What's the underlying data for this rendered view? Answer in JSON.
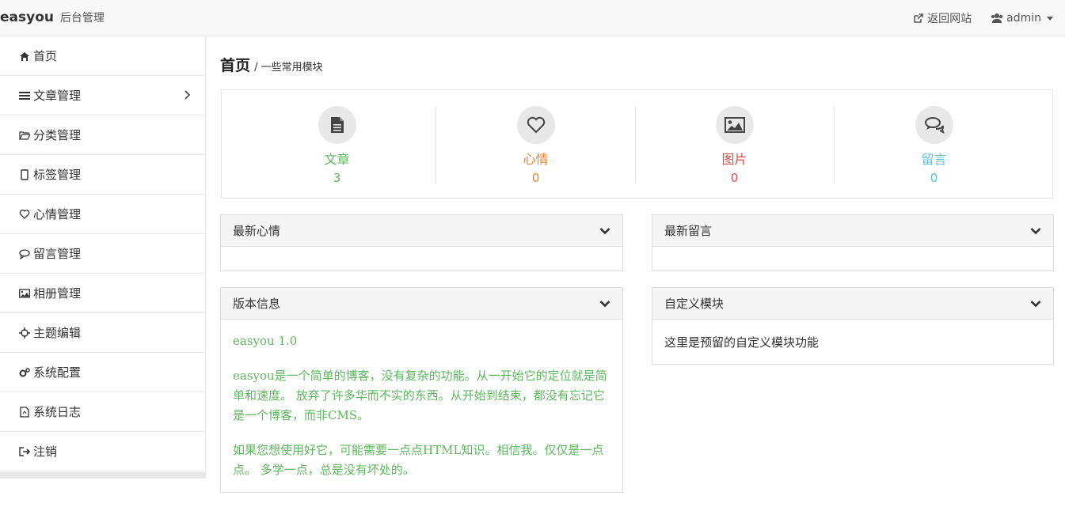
{
  "brand": {
    "name": "easyou",
    "subtitle": "后台管理"
  },
  "topnav": {
    "back_label": "返回网站",
    "user_label": "admin"
  },
  "sidebar": {
    "items": [
      {
        "label": "首页",
        "icon": "home-icon"
      },
      {
        "label": "文章管理",
        "icon": "bars-icon"
      },
      {
        "label": "分类管理",
        "icon": "folder-open-icon"
      },
      {
        "label": "标签管理",
        "icon": "tag-icon"
      },
      {
        "label": "心情管理",
        "icon": "heart-icon"
      },
      {
        "label": "留言管理",
        "icon": "comment-icon"
      },
      {
        "label": "相册管理",
        "icon": "picture-icon"
      },
      {
        "label": "主题编辑",
        "icon": "crosshairs-icon"
      },
      {
        "label": "系统配置",
        "icon": "gears-icon"
      },
      {
        "label": "系统日志",
        "icon": "file-icon"
      },
      {
        "label": "注销",
        "icon": "sign-out-icon"
      }
    ]
  },
  "page": {
    "title": "首页",
    "subtitle": "/ 一些常用模块"
  },
  "stats": [
    {
      "label": "文章",
      "value": "3",
      "color": "#5cb85c",
      "icon": "file-text-icon"
    },
    {
      "label": "心情",
      "value": "0",
      "color": "#f0ad4e",
      "icon": "heart-icon"
    },
    {
      "label": "图片",
      "value": "0",
      "color": "#d9534f",
      "icon": "picture-icon"
    },
    {
      "label": "留言",
      "value": "0",
      "color": "#5bc0de",
      "icon": "comments-icon"
    }
  ],
  "panels": {
    "latest_mood": {
      "title": "最新心情"
    },
    "latest_message": {
      "title": "最新留言"
    },
    "version": {
      "title": "版本信息",
      "version_line": "easyou 1.0",
      "para1": "easyou是一个简单的博客，没有复杂的功能。从一开始它的定位就是简单和速度。 放弃了许多华而不实的东西。从开始到结束，都没有忘记它是一个博客，而非CMS。",
      "para2": "如果您想使用好它，可能需要一点点HTML知识。相信我。仅仅是一点点。 多学一点，总是没有坏处的。"
    },
    "custom": {
      "title": "自定义模块",
      "body": "这里是预留的自定义模块功能"
    }
  }
}
